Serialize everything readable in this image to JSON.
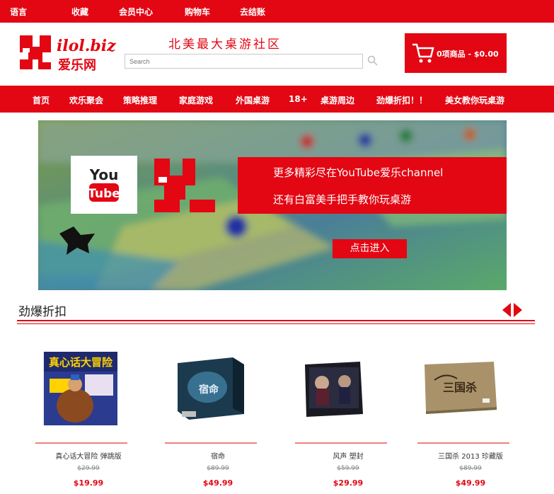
{
  "topbar": {
    "links": [
      "语言",
      "收藏",
      "会员中心",
      "购物车",
      "去结账"
    ]
  },
  "header": {
    "logo_text_top": "ilol.biz",
    "logo_text_bottom": "爱乐网",
    "slogan": "北美最大桌游社区",
    "search_placeholder": "Search",
    "search_icon": "search-icon",
    "cart_icon": "cart-icon",
    "cart_text": "0项商品 - $0.00"
  },
  "nav": {
    "items": [
      "首页",
      "欢乐聚会",
      "策略推理",
      "家庭游戏",
      "外国桌游",
      "18+",
      "桌游周边",
      "劲爆折扣！！",
      "美女教你玩桌游"
    ]
  },
  "banner": {
    "youtube_logo_top": "You",
    "youtube_logo_bottom": "Tube",
    "line1": "更多精彩尽在YouTube爱乐channel",
    "line2": "还有白富美手把手教你玩桌游",
    "button": "点击进入"
  },
  "section": {
    "title": "劲爆折扣",
    "prev_icon": "arrow-left-icon",
    "next_icon": "arrow-right-icon"
  },
  "products": [
    {
      "name": "真心话大冒险 弹跳版",
      "old_price": "$29.99",
      "price": "$19.99",
      "box_text": "真心话大冒险"
    },
    {
      "name": "宿命",
      "old_price": "$89.99",
      "price": "$49.99",
      "box_text": "宿命"
    },
    {
      "name": "风声 塑封",
      "old_price": "$59.99",
      "price": "$29.99",
      "box_text": ""
    },
    {
      "name": "三国杀 2013 珍藏版",
      "old_price": "$89.99",
      "price": "$49.99",
      "box_text": "三国杀"
    }
  ],
  "colors": {
    "brand_red": "#e30613",
    "price_red": "#e30613"
  }
}
